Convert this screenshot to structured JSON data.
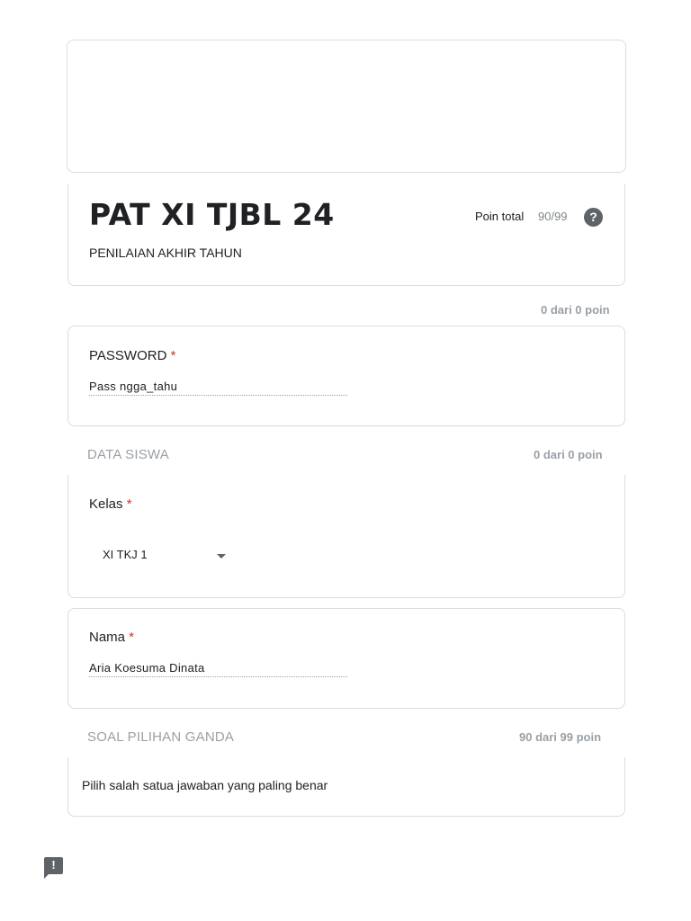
{
  "header": {
    "title": "PAT XI TJBL 24",
    "description": "PENILAIAN AKHIR TAHUN",
    "total_label": "Poin total",
    "total_value": "90/99",
    "help_icon": "help-icon"
  },
  "password_section": {
    "points": "0 dari 0 poin",
    "question": "PASSWORD",
    "required_mark": "*",
    "answer": "Pass ngga_tahu"
  },
  "data_siswa": {
    "title": "DATA SISWA",
    "points": "0 dari 0 poin",
    "kelas": {
      "question": "Kelas",
      "required_mark": "*",
      "selected": "XI TKJ 1"
    },
    "nama": {
      "question": "Nama",
      "required_mark": "*",
      "answer": "Aria Koesuma Dinata"
    }
  },
  "soal_pilihan_ganda": {
    "title": "SOAL PILIHAN GANDA",
    "points": "90 dari 99 poin",
    "description": "Pilih salah satua jawaban yang paling benar"
  },
  "feedback": {
    "icon": "report-feedback-icon",
    "glyph": "!"
  }
}
